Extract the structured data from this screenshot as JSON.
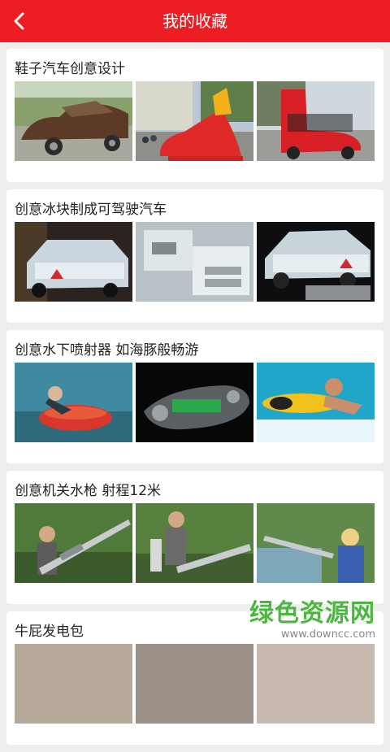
{
  "header": {
    "title": "我的收藏",
    "back_icon": "chevron-left-icon",
    "color": "#ee1d24"
  },
  "cards": [
    {
      "title": "鞋子汽车创意设计",
      "images": [
        "shoe-car-brown",
        "shoe-car-red-sneaker",
        "boot-car-red"
      ]
    },
    {
      "title": "创意冰块制成可驾驶汽车",
      "images": [
        "ice-car-front",
        "ice-car-engine",
        "ice-car-side"
      ]
    },
    {
      "title": "创意水下喷射器 如海豚般畅游",
      "images": [
        "underwater-jet-diver",
        "underwater-jet-xray",
        "jetboard-surfer"
      ]
    },
    {
      "title": "创意机关水枪 射程12米",
      "images": [
        "water-gun-man-1",
        "water-gun-man-2",
        "water-gun-woman"
      ]
    },
    {
      "title": "牛屁发电包",
      "images": [
        "cow-gas-1",
        "cow-gas-2",
        "cow-gas-3"
      ]
    }
  ],
  "watermark": {
    "main": "绿色资源网",
    "sub": "www.downcc.com"
  }
}
